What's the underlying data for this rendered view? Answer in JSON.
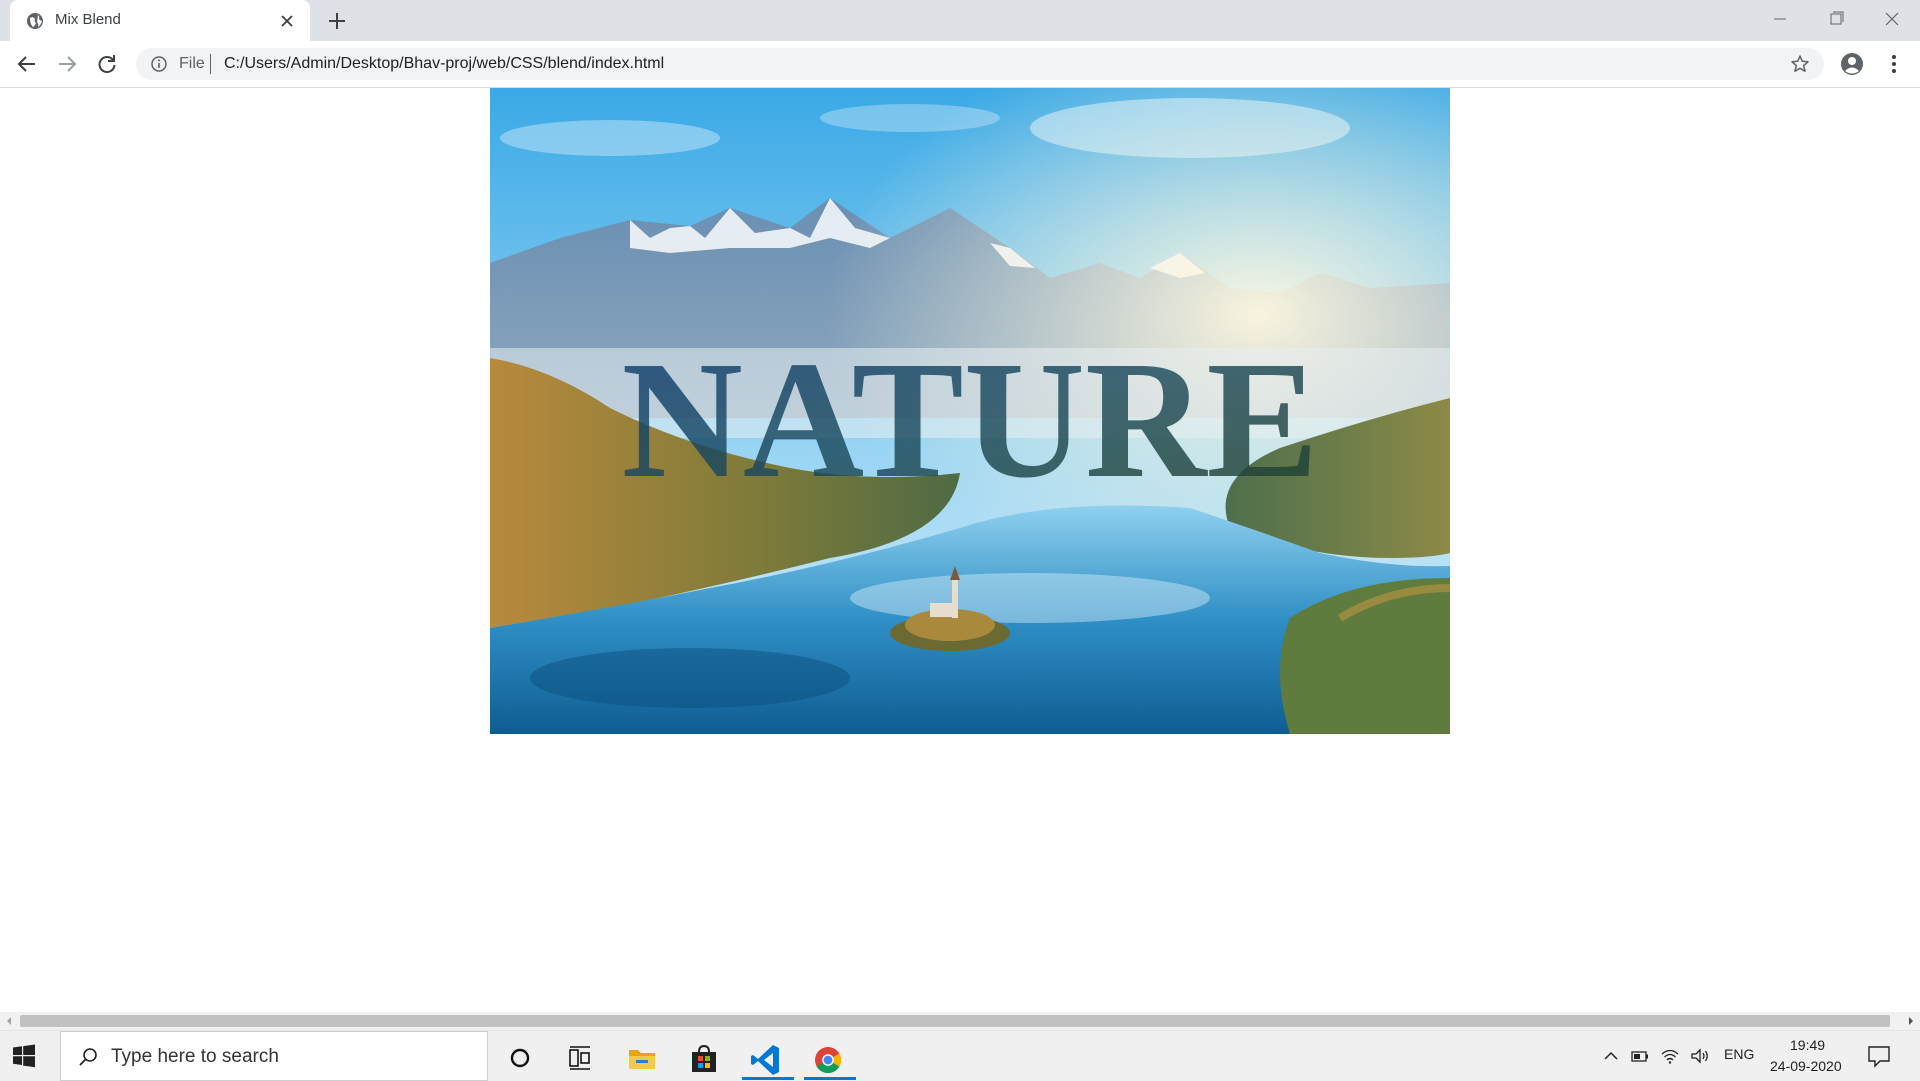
{
  "browser": {
    "tab_title": "Mix Blend",
    "address_scheme": "File",
    "address_url": "C:/Users/Admin/Desktop/Bhav-proj/web/CSS/blend/index.html"
  },
  "page": {
    "hero_text": "NATURE",
    "hero_image": "mountain-lake-landscape"
  },
  "taskbar": {
    "search_placeholder": "Type here to search",
    "pinned_apps": [
      "cortana",
      "task-view",
      "file-explorer",
      "microsoft-store",
      "visual-studio-code",
      "google-chrome"
    ],
    "tray_language": "ENG",
    "clock_time": "19:49",
    "clock_date": "24-09-2020"
  },
  "colors": {
    "tab_strip": "#dee1e6",
    "omnibox": "#f1f3f4",
    "taskbar": "#f0f0f0",
    "active_indicator": "#0078d4"
  }
}
